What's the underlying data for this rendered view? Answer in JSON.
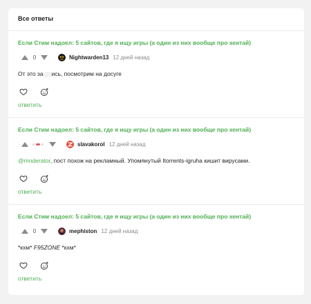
{
  "header": {
    "title": "Все ответы"
  },
  "comments": [
    {
      "post_title": "Если Стим надоел: 5 сайтов, где я ищу игры (а один из них вообще про хентай)",
      "score": "0",
      "author": "Nightwarden13",
      "time": "12 дней назад",
      "text_before": "От это за",
      "text_after": "ись, посмотрим на досуге",
      "reply_label": "ответить"
    },
    {
      "post_title": "Если Стим надоел: 5 сайтов, где я ищу игры (а один из них вообще про хентай)",
      "author": "slavakorol",
      "time": "12 дней назад",
      "mention": "@moderator",
      "text": ", пост похож на рекламный. Упомянутый Itorrents-igruha кишит вирусами.",
      "reply_label": "ответить"
    },
    {
      "post_title": "Если Стим надоел: 5 сайтов, где я ищу игры (а один из них вообще про хентай)",
      "score": "0",
      "author": "mephiston",
      "time": "12 дней назад",
      "text_a": "*кхм* ",
      "text_b": "F95ZONE",
      "text_c": " *кхм*",
      "reply_label": "ответить"
    }
  ],
  "colors": {
    "accent": "#4caf50",
    "vote_negative": "#e35b5b"
  },
  "icons": {
    "upvote": "arrow-up-icon",
    "downvote": "arrow-down-icon",
    "like": "heart-icon",
    "react": "emoji-add-icon"
  }
}
